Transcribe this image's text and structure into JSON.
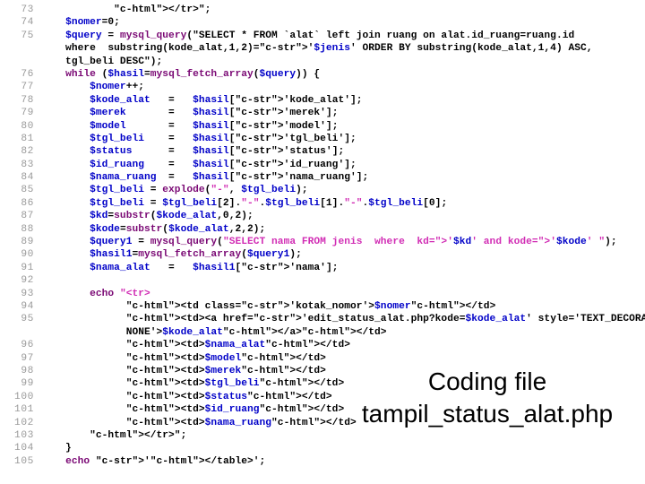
{
  "document": {
    "caption": {
      "line1": "Coding file",
      "line2": "tampil_status_alat.php"
    },
    "colors": {
      "background": "#ffffff",
      "line_number": "#9a9a9a",
      "variable": "#0000c8",
      "string": "#d12cb4",
      "keyword": "#7a0874",
      "html": "#c02ba8",
      "caption_text": "#000000"
    },
    "code": {
      "language": "php",
      "first_line_number": 73,
      "last_line_number": 105,
      "lines": [
        {
          "number": "73",
          "text": "            </tr>\";"
        },
        {
          "number": "74",
          "text": "    $nomer=0;"
        },
        {
          "number": "75",
          "text": "    $query = mysql_query(\"SELECT * FROM `alat` left join ruang on alat.id_ruang=ruang.id"
        },
        {
          "number": "",
          "text": "    where  substring(kode_alat,1,2)='$jenis' ORDER BY substring(kode_alat,1,4) ASC,"
        },
        {
          "number": "",
          "text": "    tgl_beli DESC\");"
        },
        {
          "number": "76",
          "text": "    while ($hasil=mysql_fetch_array($query)) {"
        },
        {
          "number": "77",
          "text": "        $nomer++;"
        },
        {
          "number": "78",
          "text": "        $kode_alat   =   $hasil['kode_alat'];"
        },
        {
          "number": "79",
          "text": "        $merek       =   $hasil['merek'];"
        },
        {
          "number": "80",
          "text": "        $model       =   $hasil['model'];"
        },
        {
          "number": "81",
          "text": "        $tgl_beli    =   $hasil['tgl_beli'];"
        },
        {
          "number": "82",
          "text": "        $status      =   $hasil['status'];"
        },
        {
          "number": "83",
          "text": "        $id_ruang    =   $hasil['id_ruang'];"
        },
        {
          "number": "84",
          "text": "        $nama_ruang  =   $hasil['nama_ruang'];"
        },
        {
          "number": "85",
          "text": "        $tgl_beli = explode(\"-\", $tgl_beli);"
        },
        {
          "number": "86",
          "text": "        $tgl_beli = $tgl_beli[2].\"-\".$tgl_beli[1].\"-\".$tgl_beli[0];"
        },
        {
          "number": "87",
          "text": "        $kd=substr($kode_alat,0,2);"
        },
        {
          "number": "88",
          "text": "        $kode=substr($kode_alat,2,2);"
        },
        {
          "number": "89",
          "text": "        $query1 = mysql_query(\"SELECT nama FROM jenis  where  kd='$kd' and kode='$kode' \");"
        },
        {
          "number": "90",
          "text": "        $hasil1=mysql_fetch_array($query1);"
        },
        {
          "number": "91",
          "text": "        $nama_alat   =   $hasil1['nama'];"
        },
        {
          "number": "92",
          "text": ""
        },
        {
          "number": "93",
          "text": "        echo \"<tr>"
        },
        {
          "number": "94",
          "text": "              <td class='kotak_nomor'>$nomer</td>"
        },
        {
          "number": "95",
          "text": "              <td><a href='edit_status_alat.php?kode=$kode_alat' style='TEXT_DECORATION:"
        },
        {
          "number": "",
          "text": "              NONE'>$kode_alat</a></td>"
        },
        {
          "number": "96",
          "text": "              <td>$nama_alat</td>"
        },
        {
          "number": "97",
          "text": "              <td>$model</td>"
        },
        {
          "number": "98",
          "text": "              <td>$merek</td>"
        },
        {
          "number": "99",
          "text": "              <td>$tgl_beli</td>"
        },
        {
          "number": "100",
          "text": "              <td>$status</td>"
        },
        {
          "number": "101",
          "text": "              <td>$id_ruang</td>"
        },
        {
          "number": "102",
          "text": "              <td>$nama_ruang</td>"
        },
        {
          "number": "103",
          "text": "        </tr>\";"
        },
        {
          "number": "104",
          "text": "    }"
        },
        {
          "number": "105",
          "text": "    echo '</table>';"
        }
      ]
    }
  }
}
